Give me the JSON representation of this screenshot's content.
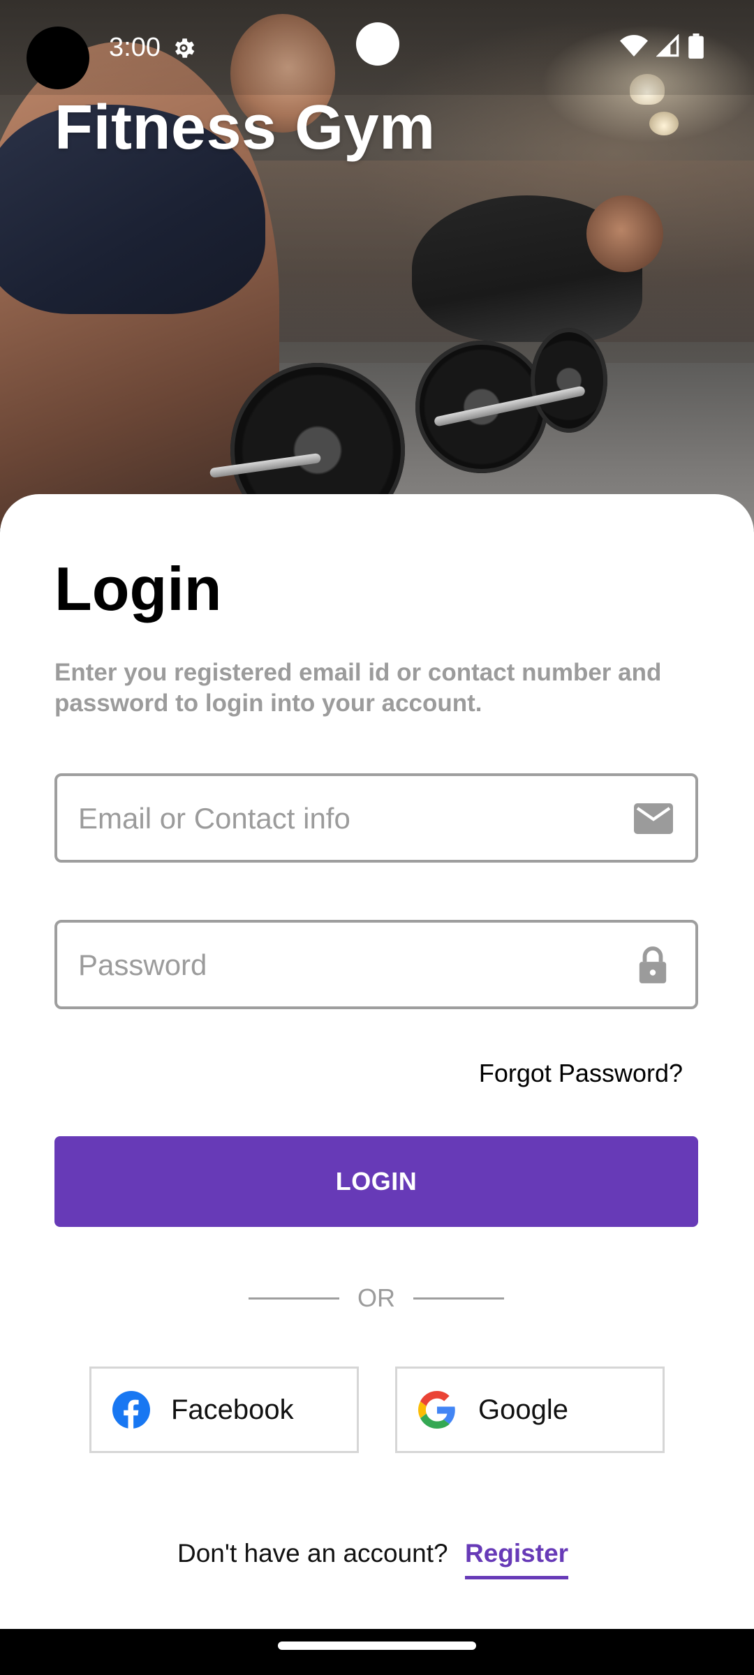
{
  "status_bar": {
    "time": "3:00",
    "icons": [
      "gear-icon",
      "wifi-icon",
      "cellular-signal-icon",
      "battery-icon"
    ]
  },
  "header": {
    "app_title": "Fitness Gym",
    "hero_image": "gym-athletes-deadlift-photo"
  },
  "login": {
    "heading": "Login",
    "subtitle": "Enter you registered email id or contact number and password to login into your account.",
    "email_field": {
      "placeholder": "Email or Contact info",
      "value": "",
      "icon": "mail-icon"
    },
    "password_field": {
      "placeholder": "Password",
      "value": "",
      "icon": "lock-icon"
    },
    "forgot_password_label": "Forgot Password?",
    "login_button_label": "LOGIN",
    "divider_text": "OR",
    "social": {
      "facebook_label": "Facebook",
      "google_label": "Google"
    },
    "register_prompt": "Don't have an account?",
    "register_label": "Register"
  },
  "colors": {
    "accent": "#673ab7",
    "field_border": "#9e9e9e",
    "muted_text": "#9b9b9b",
    "facebook_blue": "#1877f2"
  }
}
